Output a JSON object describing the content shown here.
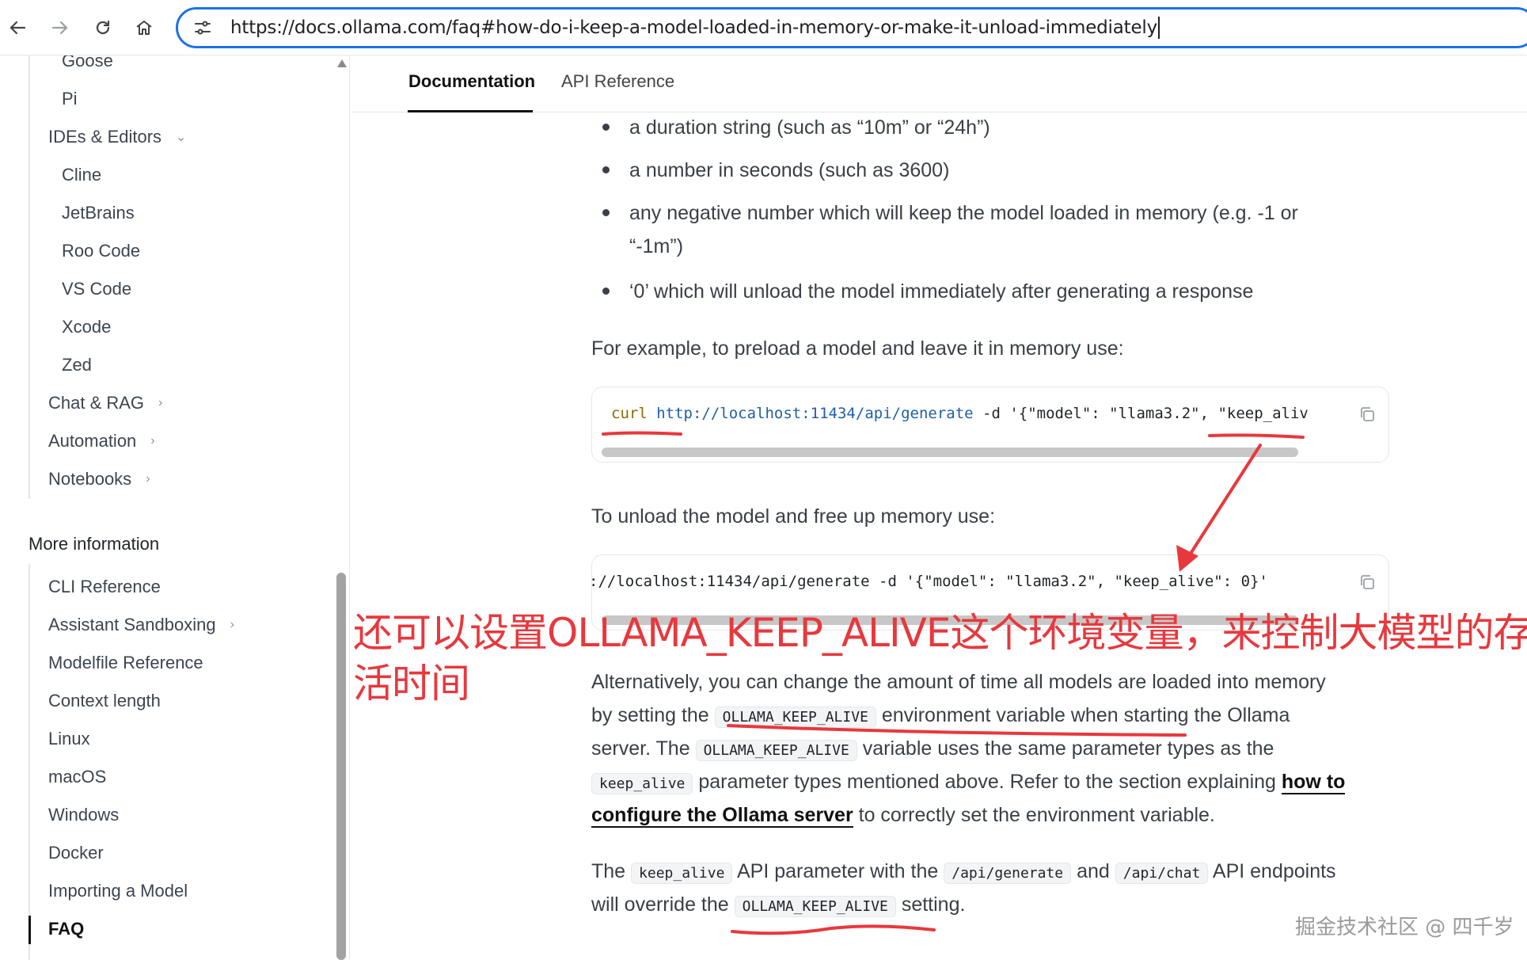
{
  "browser": {
    "url": "https://docs.ollama.com/faq#how-do-i-keep-a-model-loaded-in-memory-or-make-it-unload-immediately"
  },
  "sidebar": {
    "items_top": [
      {
        "label": "Goose"
      },
      {
        "label": "Pi"
      }
    ],
    "ides_group": {
      "label": "IDEs & Editors"
    },
    "ides_items": [
      {
        "label": "Cline"
      },
      {
        "label": "JetBrains"
      },
      {
        "label": "Roo Code"
      },
      {
        "label": "VS Code"
      },
      {
        "label": "Xcode"
      },
      {
        "label": "Zed"
      }
    ],
    "groups": [
      {
        "label": "Chat & RAG"
      },
      {
        "label": "Automation"
      },
      {
        "label": "Notebooks"
      }
    ],
    "more_heading": "More information",
    "more_items": [
      {
        "label": "CLI Reference"
      },
      {
        "label": "Assistant Sandboxing"
      },
      {
        "label": "Modelfile Reference"
      },
      {
        "label": "Context length"
      },
      {
        "label": "Linux"
      },
      {
        "label": "macOS"
      },
      {
        "label": "Windows"
      },
      {
        "label": "Docker"
      },
      {
        "label": "Importing a Model"
      },
      {
        "label": "FAQ"
      }
    ]
  },
  "tabs": {
    "documentation": "Documentation",
    "api_reference": "API Reference"
  },
  "content": {
    "bullets": [
      "a duration string (such as “10m” or “24h”)",
      "a number in seconds (such as 3600)",
      "any negative number which will keep the model loaded in memory (e.g. -1 or",
      "“-1m”)",
      "‘0’ which will unload the model immediately after generating a response"
    ],
    "preload_intro": "For example, to preload a model and leave it in memory use:",
    "code1": {
      "cmd": "curl",
      "url": "http://localhost:11434/api/generate",
      "rest": " -d '{\"model\": \"llama3.2\", \"keep_aliv"
    },
    "unload_intro": "To unload the model and free up memory use:",
    "code2": {
      "text": "://localhost:11434/api/generate -d '{\"model\": \"llama3.2\", \"keep_alive\": 0}'"
    },
    "alt": {
      "l1": "Alternatively, you can change the amount of time all models are loaded into memory",
      "l2a": "by setting the",
      "l2code": "OLLAMA_KEEP_ALIVE",
      "l2b": "environment variable when starting the Ollama",
      "l3a": "server. The",
      "l3code": "OLLAMA_KEEP_ALIVE",
      "l3b": "variable uses the same parameter types as the",
      "l4code": "keep_alive",
      "l4b": "parameter types mentioned above. Refer to the section explaining",
      "link1": "how to",
      "link2": "configure the Ollama server",
      "l5b": "to correctly set the environment variable."
    },
    "override": {
      "a": "The",
      "code1": "keep_alive",
      "b": "API parameter with the",
      "code2": "/api/generate",
      "c": "and",
      "code3": "/api/chat",
      "d": "API endpoints",
      "e": "will override the",
      "code4": "OLLAMA_KEEP_ALIVE",
      "f": "setting."
    }
  },
  "annotation": {
    "line1": "还可以设置OLLAMA_KEEP_ALIVE这个环境变量，来控制大模型的存",
    "line2": "活时间",
    "color": "#e8383d"
  },
  "watermark": "掘金技术社区 @ 四千岁"
}
